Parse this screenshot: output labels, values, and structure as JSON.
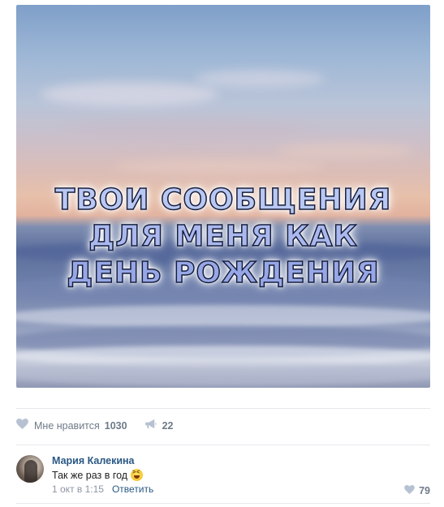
{
  "post": {
    "image_caption_lines": [
      "ТВОИ СООБЩЕНИЯ",
      "ДЛЯ МЕНЯ КАК",
      "ДЕНЬ РОЖДЕНИЯ"
    ]
  },
  "actions": {
    "like_label": "Мне нравится",
    "like_count": "1030",
    "share_count": "22"
  },
  "comment": {
    "author": "Мария Калекина",
    "text": "Так же раз в год",
    "emoji": "laughing-emoji",
    "timestamp": "1 окт в 1:15",
    "reply_label": "Ответить",
    "like_count": "79"
  },
  "colors": {
    "link": "#2a5885",
    "muted": "#6f7a89",
    "icon": "#b6c2d2",
    "divider": "#e7e8ec"
  },
  "icons": {
    "like": "heart-icon",
    "share": "megaphone-icon"
  }
}
